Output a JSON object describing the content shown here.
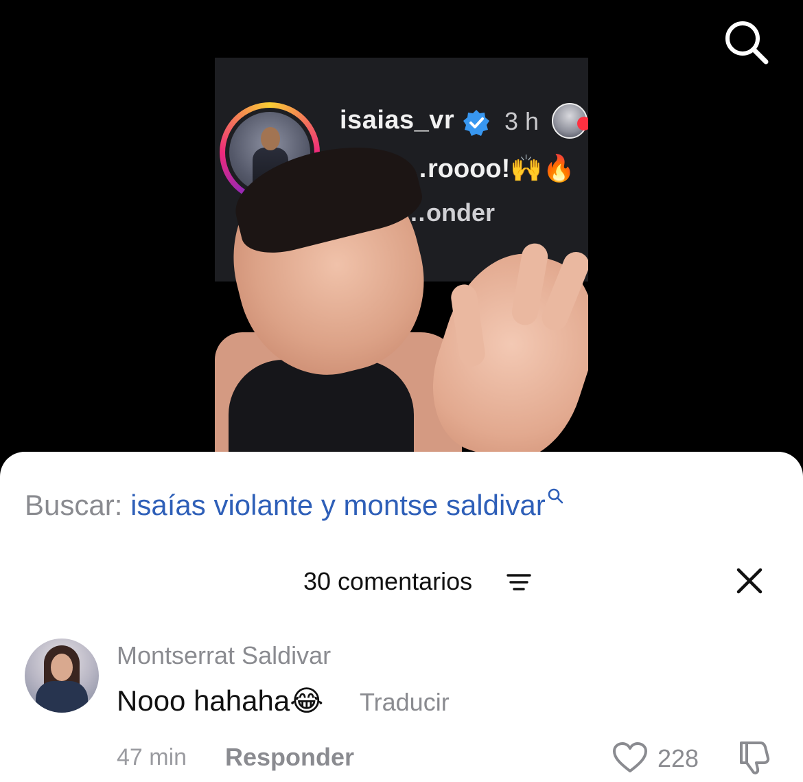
{
  "video": {
    "search_icon": "search-icon",
    "screenshot": {
      "username": "isaias_vr",
      "time": "3 h",
      "comment": "…roooo!🙌🔥",
      "reply_label": "…onder"
    }
  },
  "search_suggestion": {
    "prefix": "Buscar:",
    "query": "isaías violante y montse saldivar"
  },
  "comments_header": {
    "title": "30 comentarios",
    "sort_icon": "sort-lines-icon",
    "close_icon": "close-icon"
  },
  "comment": {
    "author": "Montserrat Saldivar",
    "text": "Nooo hahaha",
    "emoji": "😂",
    "translate_label": "Traducir",
    "time": "47 min",
    "reply_label": "Responder",
    "like_count": "228"
  },
  "colors": {
    "link_blue": "#2e5fb8",
    "muted_gray": "#8a8b90",
    "verified_blue": "#3897f0"
  }
}
